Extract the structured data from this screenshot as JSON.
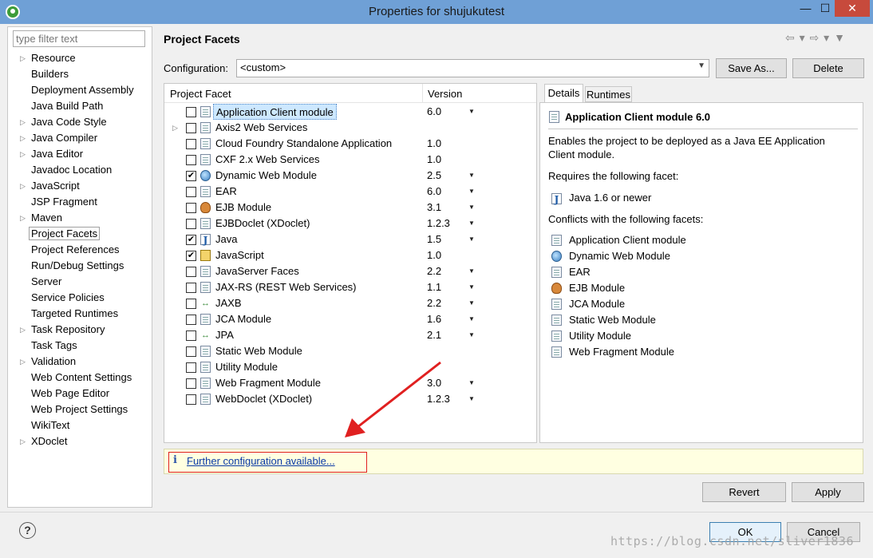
{
  "window": {
    "title": "Properties for shujukutest",
    "minimize": "—",
    "maximize": "☐",
    "close": "✕"
  },
  "filter": {
    "placeholder": "type filter text"
  },
  "nav": {
    "items": [
      {
        "label": "Resource",
        "expandable": true
      },
      {
        "label": "Builders",
        "expandable": false
      },
      {
        "label": "Deployment Assembly",
        "expandable": false
      },
      {
        "label": "Java Build Path",
        "expandable": false
      },
      {
        "label": "Java Code Style",
        "expandable": true
      },
      {
        "label": "Java Compiler",
        "expandable": true
      },
      {
        "label": "Java Editor",
        "expandable": true
      },
      {
        "label": "Javadoc Location",
        "expandable": false
      },
      {
        "label": "JavaScript",
        "expandable": true
      },
      {
        "label": "JSP Fragment",
        "expandable": false
      },
      {
        "label": "Maven",
        "expandable": true
      },
      {
        "label": "Project Facets",
        "expandable": false,
        "selected": true
      },
      {
        "label": "Project References",
        "expandable": false
      },
      {
        "label": "Run/Debug Settings",
        "expandable": false
      },
      {
        "label": "Server",
        "expandable": false
      },
      {
        "label": "Service Policies",
        "expandable": false
      },
      {
        "label": "Targeted Runtimes",
        "expandable": false
      },
      {
        "label": "Task Repository",
        "expandable": true
      },
      {
        "label": "Task Tags",
        "expandable": false
      },
      {
        "label": "Validation",
        "expandable": true
      },
      {
        "label": "Web Content Settings",
        "expandable": false
      },
      {
        "label": "Web Page Editor",
        "expandable": false
      },
      {
        "label": "Web Project Settings",
        "expandable": false
      },
      {
        "label": "WikiText",
        "expandable": false
      },
      {
        "label": "XDoclet",
        "expandable": true
      }
    ]
  },
  "page": {
    "heading": "Project Facets",
    "history_nav": "⇦ ▾ ⇨ ▾ ▼"
  },
  "configuration": {
    "label": "Configuration:",
    "value": "<custom>",
    "save_as_label": "Save As...",
    "delete_label": "Delete"
  },
  "facets": {
    "col_facet": "Project Facet",
    "col_version": "Version",
    "rows": [
      {
        "name": "Application Client module",
        "version": "6.0",
        "checked": false,
        "dropdown": true,
        "icon": "page",
        "selected": true
      },
      {
        "name": "Axis2 Web Services",
        "version": "",
        "checked": false,
        "dropdown": false,
        "icon": "page",
        "expandable": true
      },
      {
        "name": "Cloud Foundry Standalone Application",
        "version": "1.0",
        "checked": false,
        "dropdown": false,
        "icon": "page"
      },
      {
        "name": "CXF 2.x Web Services",
        "version": "1.0",
        "checked": false,
        "dropdown": false,
        "icon": "page"
      },
      {
        "name": "Dynamic Web Module",
        "version": "2.5",
        "checked": true,
        "dropdown": true,
        "icon": "globe"
      },
      {
        "name": "EAR",
        "version": "6.0",
        "checked": false,
        "dropdown": true,
        "icon": "page"
      },
      {
        "name": "EJB Module",
        "version": "3.1",
        "checked": false,
        "dropdown": true,
        "icon": "bean"
      },
      {
        "name": "EJBDoclet (XDoclet)",
        "version": "1.2.3",
        "checked": false,
        "dropdown": true,
        "icon": "page"
      },
      {
        "name": "Java",
        "version": "1.5",
        "checked": true,
        "dropdown": true,
        "icon": "j"
      },
      {
        "name": "JavaScript",
        "version": "1.0",
        "checked": true,
        "dropdown": false,
        "icon": "lock"
      },
      {
        "name": "JavaServer Faces",
        "version": "2.2",
        "checked": false,
        "dropdown": true,
        "icon": "page"
      },
      {
        "name": "JAX-RS (REST Web Services)",
        "version": "1.1",
        "checked": false,
        "dropdown": true,
        "icon": "page"
      },
      {
        "name": "JAXB",
        "version": "2.2",
        "checked": false,
        "dropdown": true,
        "icon": "arrows"
      },
      {
        "name": "JCA Module",
        "version": "1.6",
        "checked": false,
        "dropdown": true,
        "icon": "page"
      },
      {
        "name": "JPA",
        "version": "2.1",
        "checked": false,
        "dropdown": true,
        "icon": "arrows"
      },
      {
        "name": "Static Web Module",
        "version": "",
        "checked": false,
        "dropdown": false,
        "icon": "page"
      },
      {
        "name": "Utility Module",
        "version": "",
        "checked": false,
        "dropdown": false,
        "icon": "page"
      },
      {
        "name": "Web Fragment Module",
        "version": "3.0",
        "checked": false,
        "dropdown": true,
        "icon": "page"
      },
      {
        "name": "WebDoclet (XDoclet)",
        "version": "1.2.3",
        "checked": false,
        "dropdown": true,
        "icon": "page"
      }
    ]
  },
  "details": {
    "tab_details": "Details",
    "tab_runtimes": "Runtimes",
    "title": "Application Client module 6.0",
    "description": "Enables the project to be deployed as a Java EE Application Client module.",
    "requires_label": "Requires the following facet:",
    "requires_item": "Java 1.6 or newer",
    "conflicts_label": "Conflicts with the following facets:",
    "conflicts": [
      {
        "name": "Application Client module",
        "icon": "page"
      },
      {
        "name": "Dynamic Web Module",
        "icon": "globe"
      },
      {
        "name": "EAR",
        "icon": "page"
      },
      {
        "name": "EJB Module",
        "icon": "bean"
      },
      {
        "name": "JCA Module",
        "icon": "page"
      },
      {
        "name": "Static Web Module",
        "icon": "page"
      },
      {
        "name": "Utility Module",
        "icon": "page"
      },
      {
        "name": "Web Fragment Module",
        "icon": "page"
      }
    ]
  },
  "infobar": {
    "icon": "i",
    "link": "Further configuration available..."
  },
  "buttons": {
    "revert": "Revert",
    "apply": "Apply",
    "ok": "OK",
    "cancel": "Cancel",
    "help": "?"
  },
  "watermark": "https://blog.csdn.net/sliver1836"
}
